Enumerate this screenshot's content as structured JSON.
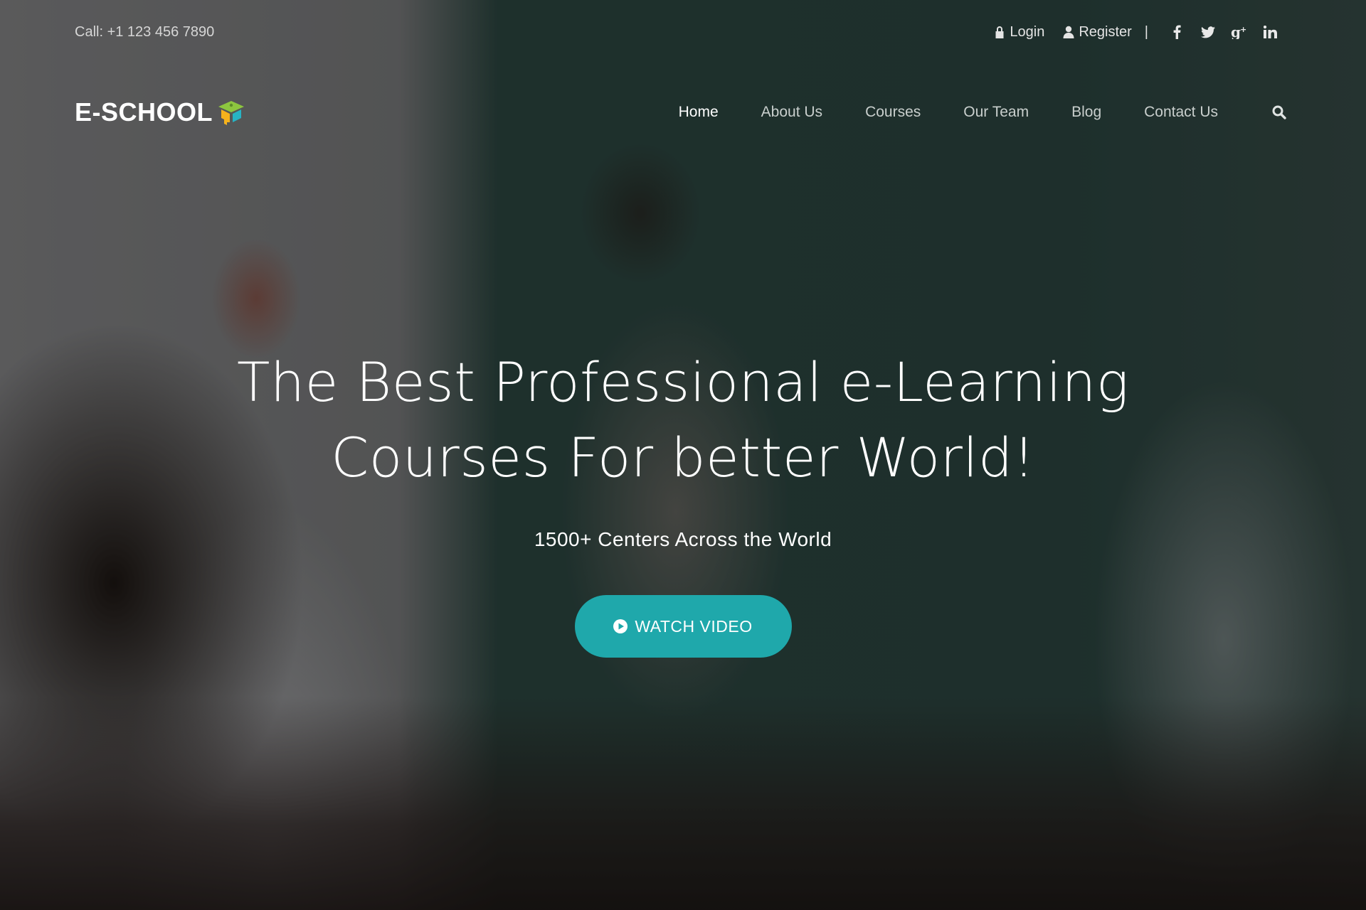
{
  "topbar": {
    "phone": "Call: +1 123 456 7890",
    "login_label": "Login",
    "register_label": "Register",
    "separator": "|",
    "social": [
      {
        "name": "facebook-icon",
        "glyph": "f"
      },
      {
        "name": "twitter-icon",
        "glyph": "t"
      },
      {
        "name": "google-plus-icon",
        "glyph": "g+"
      },
      {
        "name": "linkedin-icon",
        "glyph": "in"
      }
    ]
  },
  "brand": {
    "logo_text": "E-SCHOOL",
    "logo_icon": "graduation-cap-icon"
  },
  "nav": {
    "items": [
      {
        "label": "Home",
        "active": true
      },
      {
        "label": "About Us",
        "active": false
      },
      {
        "label": "Courses",
        "active": false
      },
      {
        "label": "Our Team",
        "active": false
      },
      {
        "label": "Blog",
        "active": false
      },
      {
        "label": "Contact Us",
        "active": false
      }
    ],
    "search_icon": "search-icon"
  },
  "hero": {
    "title_line1": "The Best Professional e-Learning",
    "title_line2": "Courses For better World!",
    "subtitle": "1500+ Centers Across the World",
    "button_label": "WATCH VIDEO",
    "button_icon": "play-circle-icon"
  },
  "colors": {
    "accent": "#1fa8ab",
    "logo_green": "#8dc63f",
    "logo_yellow": "#f6b21c",
    "logo_teal": "#27b3c4"
  }
}
